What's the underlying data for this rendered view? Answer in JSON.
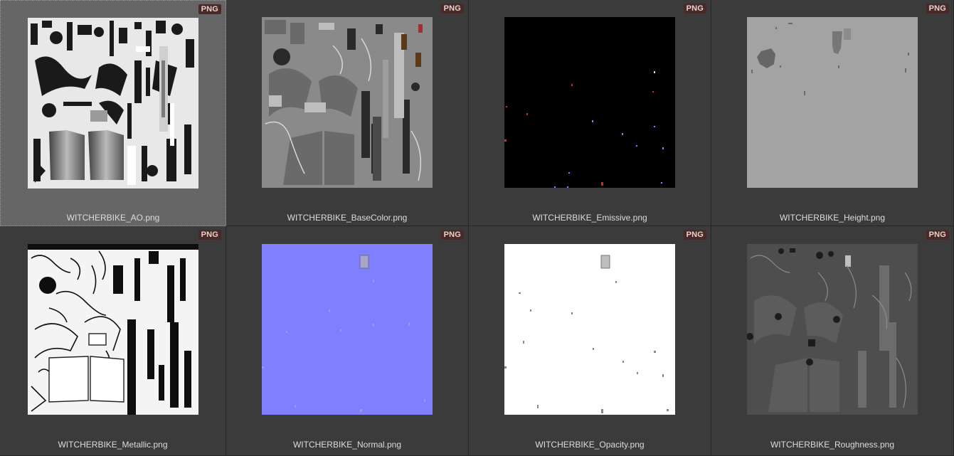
{
  "badge_label": "PNG",
  "files": [
    {
      "name": "WITCHERBIKE_AO.png",
      "texture": "ao-texture"
    },
    {
      "name": "WITCHERBIKE_BaseColor.png",
      "texture": "basecolor-texture"
    },
    {
      "name": "WITCHERBIKE_Emissive.png",
      "texture": "emissive-texture"
    },
    {
      "name": "WITCHERBIKE_Height.png",
      "texture": "height-texture"
    },
    {
      "name": "WITCHERBIKE_Metallic.png",
      "texture": "metallic-texture"
    },
    {
      "name": "WITCHERBIKE_Normal.png",
      "texture": "normal-texture"
    },
    {
      "name": "WITCHERBIKE_Opacity.png",
      "texture": "opacity-texture"
    },
    {
      "name": "WITCHERBIKE_Roughness.png",
      "texture": "roughness-texture"
    }
  ],
  "colors": {
    "panel_bg": "#3b3b3b",
    "selected_bg": "#666666",
    "badge_bg": "#4a2a28",
    "normal_map": "#8080ff"
  }
}
